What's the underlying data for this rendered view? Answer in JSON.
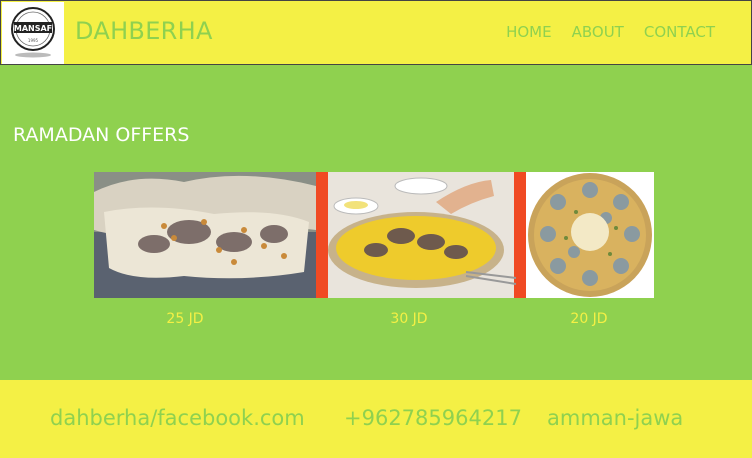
{
  "header": {
    "logo_text": "MANSAF",
    "logo_subtext": "1995",
    "brand": "DAHBERHA",
    "nav": [
      "HOME",
      "ABOUT",
      "CONTACT"
    ]
  },
  "main": {
    "section_title": "RAMADAN OFFERS",
    "offers": [
      {
        "image": "mansaf-dish-photo-1",
        "price": "25 JD"
      },
      {
        "image": "mansaf-dish-photo-2",
        "price": "30 JD"
      },
      {
        "image": "mansaf-platter-photo-3",
        "price": "20 JD"
      }
    ]
  },
  "footer": {
    "facebook": "dahberha/facebook.com",
    "phone": "+962785964217",
    "location": "amman-jawa"
  },
  "colors": {
    "header_bg": "#f4f045",
    "body_bg": "#8fd14f",
    "accent_text": "#8fd14f",
    "price_text": "#f4f045"
  }
}
